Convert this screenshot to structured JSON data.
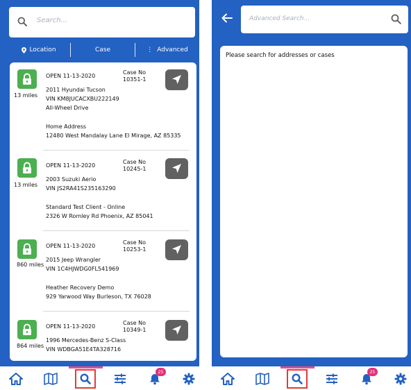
{
  "left": {
    "search": {
      "placeholder": "Search..."
    },
    "filters": {
      "location": "Location",
      "case": "Case",
      "advanced": "Advanced"
    },
    "cases": [
      {
        "open": "OPEN 11-13-2020",
        "case_no_label": "Case No",
        "case_no": "10351-1",
        "distance": "13 miles",
        "vehicle": "2011 Hyundai Tucson",
        "vin": "VIN KM8JUCACXBU222149",
        "detail": "All-Wheel Drive",
        "client": "Home Address",
        "address": "12480 West Mandalay Lane  El Mirage, AZ 85335"
      },
      {
        "open": "OPEN 11-13-2020",
        "case_no_label": "Case No",
        "case_no": "10245-1",
        "distance": "13 miles",
        "vehicle": "2003 Suzuki Aerio",
        "vin": "VIN JS2RA41S235163290",
        "detail": "",
        "client": "Standard Test Client - Online",
        "address": "2326 W Romley Rd  Phoenix, AZ 85041"
      },
      {
        "open": "OPEN 11-13-2020",
        "case_no_label": "Case No",
        "case_no": "10253-1",
        "distance": "860 miles",
        "vehicle": "2015 Jeep Wrangler",
        "vin": "VIN 1C4HJWDG0FL541969",
        "detail": "",
        "client": "Heather Recovery Demo",
        "address": "929 Yarwood Way  Burleson, TX 76028"
      },
      {
        "open": "OPEN 11-13-2020",
        "case_no_label": "Case No",
        "case_no": "10349-1",
        "distance": "864 miles",
        "vehicle": "1996 Mercedes-Benz S-Class",
        "vin": "VIN WDBGA51E4TA328716",
        "detail": "",
        "client": "",
        "address": ""
      }
    ]
  },
  "right": {
    "search": {
      "placeholder": "Advanced Search..."
    },
    "message": "Please search for addresses or cases"
  },
  "bottom_nav": {
    "badge_count": "25"
  },
  "colors": {
    "primary": "#2361c2",
    "lock_green": "#4caf50",
    "badge": "#e53078",
    "active_outline": "#e53935",
    "indicator": "#ea4b86"
  }
}
